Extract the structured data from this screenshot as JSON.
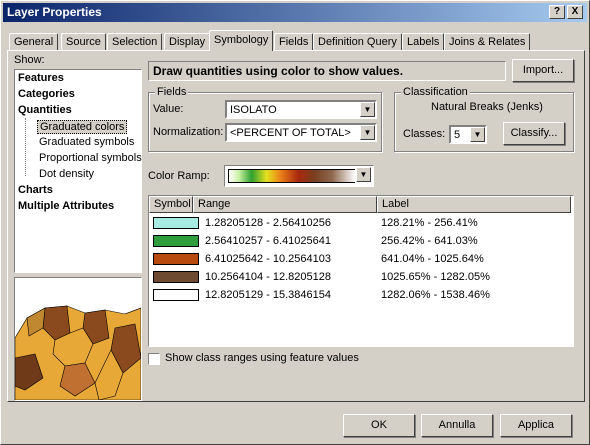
{
  "window": {
    "title": "Layer Properties"
  },
  "titlebar_buttons": {
    "help": "?",
    "close": "X"
  },
  "tabs": [
    "General",
    "Source",
    "Selection",
    "Display",
    "Symbology",
    "Fields",
    "Definition Query",
    "Labels",
    "Joins & Relates"
  ],
  "show": {
    "label": "Show:",
    "items": [
      "Features",
      "Categories",
      "Quantities"
    ],
    "sub": [
      "Graduated colors",
      "Graduated symbols",
      "Proportional symbols",
      "Dot density"
    ],
    "items2": [
      "Charts",
      "Multiple Attributes"
    ]
  },
  "description": "Draw quantities using color to show values.",
  "import_label": "Import...",
  "fields": {
    "title": "Fields",
    "value_label": "Value:",
    "value": "ISOLATO",
    "normalization_label": "Normalization:",
    "normalization": "<PERCENT OF TOTAL>"
  },
  "classification": {
    "title": "Classification",
    "method": "Natural Breaks (Jenks)",
    "classes_label": "Classes:",
    "classes": "5",
    "classify_label": "Classify..."
  },
  "color_ramp_label": "Color Ramp:",
  "table": {
    "headers": {
      "symbol": "Symbol",
      "range": "Range",
      "label": "Label"
    },
    "rows": [
      {
        "color": "#a6ece2",
        "range": "1.28205128 - 2.56410256",
        "label": "128.21% - 256.41%"
      },
      {
        "color": "#2e9e3c",
        "range": "2.56410257 - 6.41025641",
        "label": "256.42% - 641.03%"
      },
      {
        "color": "#b84a10",
        "range": "6.41025642 - 10.2564103",
        "label": "641.04% - 1025.64%"
      },
      {
        "color": "#6e4a30",
        "range": "10.2564104 - 12.8205128",
        "label": "1025.65% - 1282.05%"
      },
      {
        "color": "#ffffff",
        "range": "12.8205129 - 15.3846154",
        "label": "1282.06% - 1538.46%"
      }
    ]
  },
  "show_ranges_label": "Show class ranges using feature values",
  "buttons": {
    "ok": "OK",
    "cancel": "Annulla",
    "apply": "Applica"
  },
  "colors": {
    "title_start": "#0a246a",
    "title_end": "#a6caf0",
    "face": "#d4d0c8"
  }
}
